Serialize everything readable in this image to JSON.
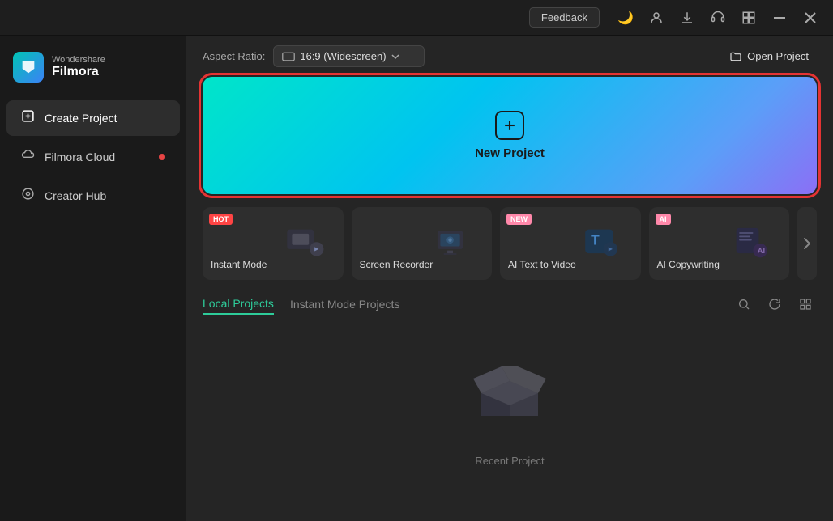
{
  "titlebar": {
    "feedback_label": "Feedback",
    "minimize_label": "—",
    "close_label": "✕",
    "icons": {
      "theme": "🌙",
      "avatar": "👤",
      "download": "⬇",
      "headset": "🎧",
      "grid": "⊞"
    }
  },
  "sidebar": {
    "logo_top": "Wondershare",
    "logo_bottom": "Filmora",
    "items": [
      {
        "id": "create-project",
        "label": "Create Project",
        "icon": "⊕",
        "active": true,
        "dot": false
      },
      {
        "id": "filmora-cloud",
        "label": "Filmora Cloud",
        "icon": "☁",
        "active": false,
        "dot": true
      },
      {
        "id": "creator-hub",
        "label": "Creator Hub",
        "icon": "◎",
        "active": false,
        "dot": false
      }
    ]
  },
  "toolbar": {
    "aspect_label": "Aspect Ratio:",
    "aspect_icon": "▭",
    "aspect_value": "16:9 (Widescreen)",
    "open_project_label": "Open Project",
    "folder_icon": "📁"
  },
  "new_project": {
    "icon": "+",
    "label": "New Project"
  },
  "quick_actions": [
    {
      "id": "instant-mode",
      "label": "Instant Mode",
      "badge": "HOT",
      "badge_type": "hot",
      "emoji": "🎬"
    },
    {
      "id": "screen-recorder",
      "label": "Screen Recorder",
      "badge": null,
      "badge_type": null,
      "emoji": "🖥"
    },
    {
      "id": "ai-text-to-video",
      "label": "AI Text to Video",
      "badge": "NEW",
      "badge_type": "new",
      "emoji": "🅣"
    },
    {
      "id": "ai-copywriting",
      "label": "AI Copywriting",
      "badge": "AI",
      "badge_type": "new",
      "emoji": "✍"
    }
  ],
  "projects": {
    "tabs": [
      {
        "id": "local",
        "label": "Local Projects",
        "active": true
      },
      {
        "id": "instant",
        "label": "Instant Mode Projects",
        "active": false
      }
    ],
    "empty_label": "Recent Project",
    "search_icon": "🔍",
    "refresh_icon": "↻",
    "grid_icon": "⊞"
  }
}
